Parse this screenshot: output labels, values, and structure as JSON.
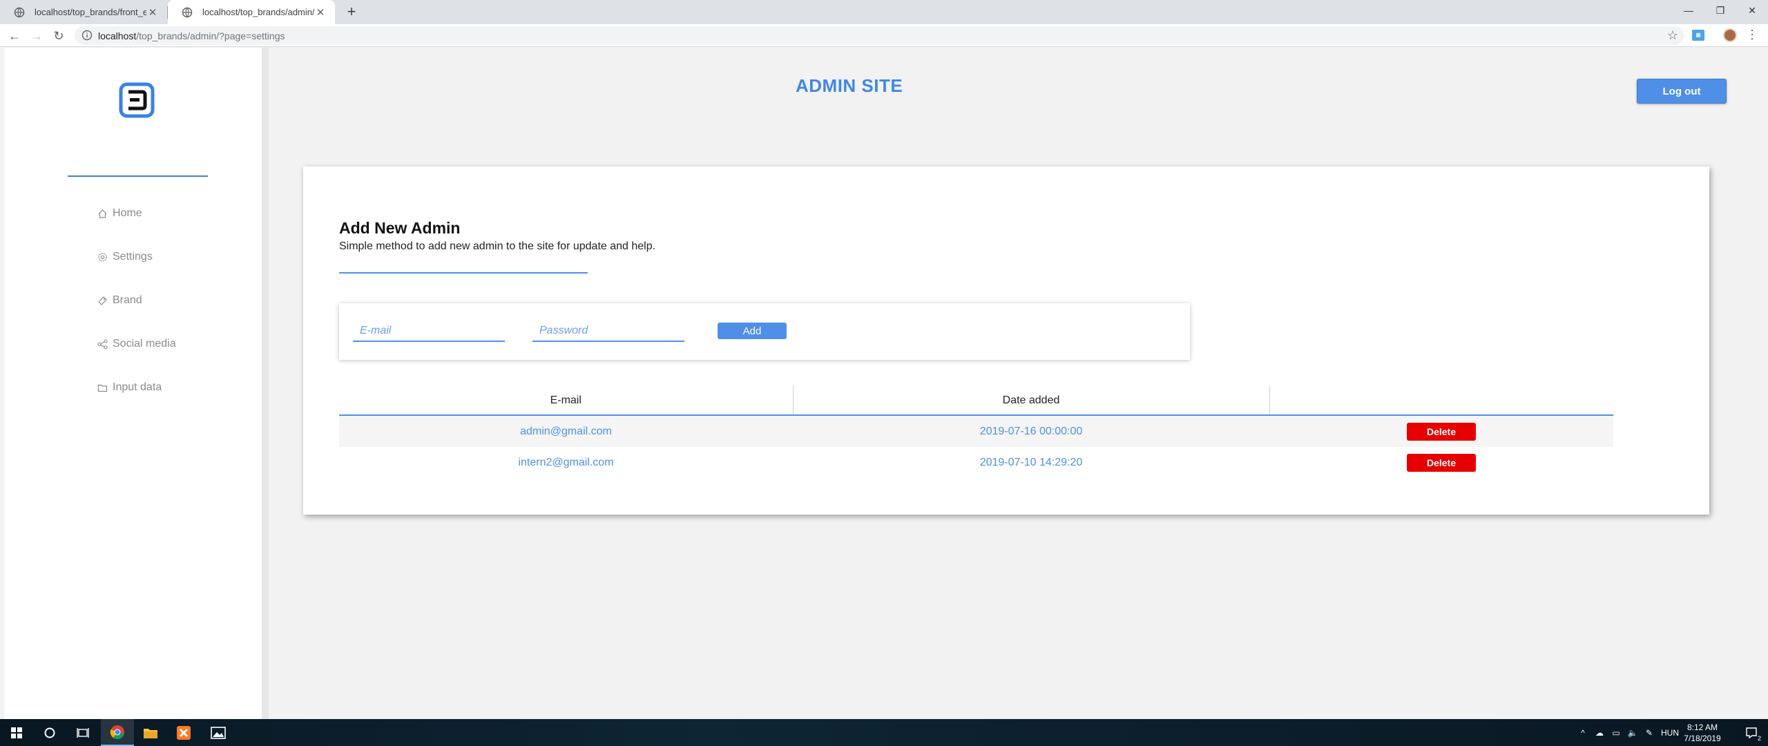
{
  "browser": {
    "tabs": [
      {
        "title": "localhost/top_brands/front_end/"
      },
      {
        "title": "localhost/top_brands/admin/?pa"
      }
    ],
    "url_host": "localhost",
    "url_path": "/top_brands/admin/?page=settings"
  },
  "header": {
    "title": "ADMIN SITE",
    "logout_label": "Log out"
  },
  "sidebar": {
    "items": [
      {
        "label": "Home",
        "icon": "home-icon"
      },
      {
        "label": "Settings",
        "icon": "gear-icon"
      },
      {
        "label": "Brand",
        "icon": "brand-icon"
      },
      {
        "label": "Social media",
        "icon": "share-icon"
      },
      {
        "label": "Input data",
        "icon": "folder-icon"
      }
    ]
  },
  "card": {
    "title": "Add New Admin",
    "subtitle": "Simple method to add new admin to the site for update and help.",
    "form": {
      "email_placeholder": "E-mail",
      "password_placeholder": "Password",
      "add_label": "Add"
    },
    "table": {
      "columns": [
        "E-mail",
        "Date added",
        ""
      ],
      "rows": [
        {
          "email": "admin@gmail.com",
          "date": "2019-07-16 00:00:00",
          "action": "Delete"
        },
        {
          "email": "intern2@gmail.com",
          "date": "2019-07-10 14:29:20",
          "action": "Delete"
        }
      ]
    }
  },
  "taskbar": {
    "language": "HUN",
    "time": "8:12 AM",
    "date": "7/18/2019",
    "notifications": "2"
  },
  "colors": {
    "accent": "#4f8fe8",
    "danger": "#e60000",
    "page_bg": "#f2f2f2"
  }
}
